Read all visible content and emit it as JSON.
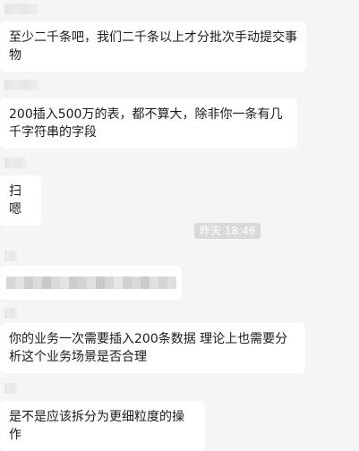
{
  "messages": [
    {
      "text": "至少二千条吧，我们二千条以上才分批次手动提交事物"
    },
    {
      "text": "200插入500万的表，都不算大，除非你一条有几千字符串的字段"
    },
    {
      "text": "扫嗯"
    },
    {
      "text": "你的业务一次需要插入200条数据 理论上也需要分析这个业务场景是否合理"
    },
    {
      "text": "是不是应该拆分为更细粒度的操作"
    }
  ],
  "timestamp": "昨天 18:46",
  "colors": {
    "background": "#f5f5f5",
    "bubble": "#ffffff",
    "timestamp_bg": "#dadada"
  }
}
